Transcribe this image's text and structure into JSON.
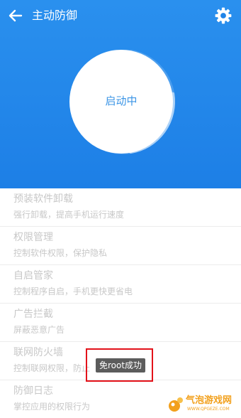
{
  "header": {
    "title": "主动防御",
    "back_icon": "back-arrow-icon",
    "settings_icon": "gear-icon"
  },
  "status": {
    "text": "启动中",
    "progress": 0.25
  },
  "items": [
    {
      "title": "预装软件卸载",
      "subtitle": "强行卸载，提高手机运行速度"
    },
    {
      "title": "权限管理",
      "subtitle": "控制软件权限，保护隐私"
    },
    {
      "title": "自启管家",
      "subtitle": "控制程序自启，手机更快更省电"
    },
    {
      "title": "广告拦截",
      "subtitle": "屏蔽恶意广告"
    },
    {
      "title": "联网防火墙",
      "subtitle": "控制联网权限，防止"
    },
    {
      "title": "防御日志",
      "subtitle": "掌控应用的权限行为"
    }
  ],
  "toast": "免root成功",
  "watermark": {
    "name": "气泡游戏网",
    "url": "WWW.QPGEZE.COM"
  },
  "colors": {
    "primary": "#1f84e8",
    "accent_text": "#3b95e6",
    "toast_bg": "#5c5c5c",
    "highlight_border": "#e3121a"
  }
}
